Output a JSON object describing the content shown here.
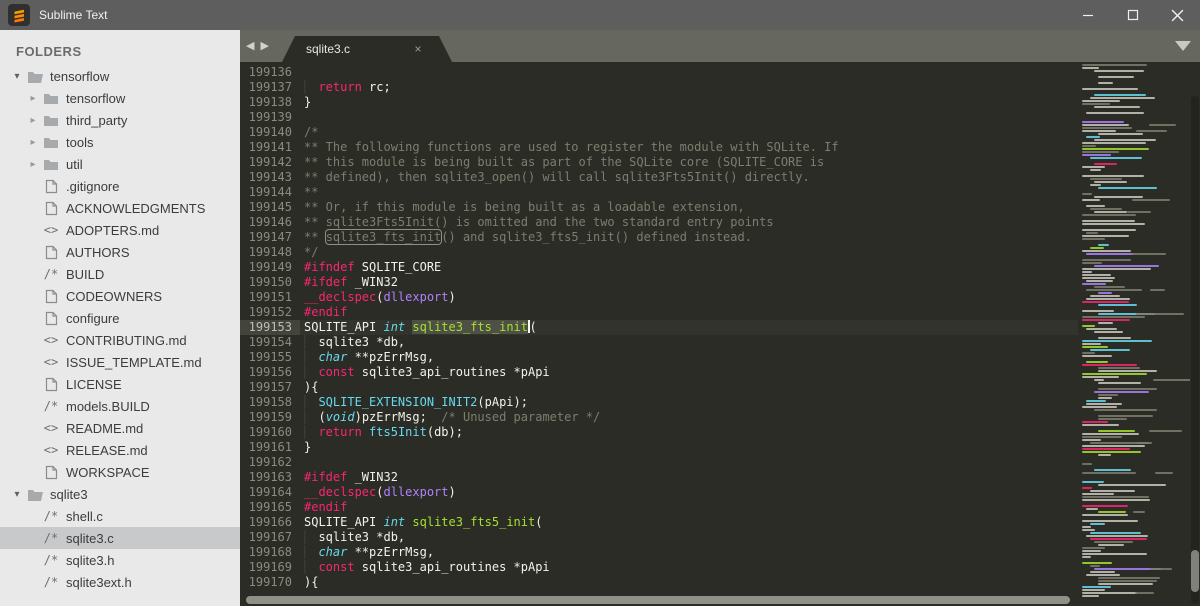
{
  "window": {
    "title": "Sublime Text",
    "controls": {
      "minimize": "minimize",
      "maximize": "maximize",
      "close": "close"
    }
  },
  "sidebar": {
    "header": "FOLDERS",
    "items": [
      {
        "label": "tensorflow",
        "icon": "folder-open",
        "depth": 0,
        "expanded": true,
        "selected": false
      },
      {
        "label": "tensorflow",
        "icon": "folder",
        "depth": 1,
        "expanded": false,
        "selected": false
      },
      {
        "label": "third_party",
        "icon": "folder",
        "depth": 1,
        "expanded": false,
        "selected": false
      },
      {
        "label": "tools",
        "icon": "folder",
        "depth": 1,
        "expanded": false,
        "selected": false
      },
      {
        "label": "util",
        "icon": "folder",
        "depth": 1,
        "expanded": false,
        "selected": false
      },
      {
        "label": ".gitignore",
        "icon": "file",
        "depth": 1,
        "selected": false
      },
      {
        "label": "ACKNOWLEDGMENTS",
        "icon": "file",
        "depth": 1,
        "selected": false
      },
      {
        "label": "ADOPTERS.md",
        "icon": "markdown",
        "depth": 1,
        "selected": false
      },
      {
        "label": "AUTHORS",
        "icon": "file",
        "depth": 1,
        "selected": false
      },
      {
        "label": "BUILD",
        "icon": "source",
        "depth": 1,
        "selected": false
      },
      {
        "label": "CODEOWNERS",
        "icon": "file",
        "depth": 1,
        "selected": false
      },
      {
        "label": "configure",
        "icon": "file",
        "depth": 1,
        "selected": false
      },
      {
        "label": "CONTRIBUTING.md",
        "icon": "markdown",
        "depth": 1,
        "selected": false
      },
      {
        "label": "ISSUE_TEMPLATE.md",
        "icon": "markdown",
        "depth": 1,
        "selected": false
      },
      {
        "label": "LICENSE",
        "icon": "file",
        "depth": 1,
        "selected": false
      },
      {
        "label": "models.BUILD",
        "icon": "source",
        "depth": 1,
        "selected": false
      },
      {
        "label": "README.md",
        "icon": "markdown",
        "depth": 1,
        "selected": false
      },
      {
        "label": "RELEASE.md",
        "icon": "markdown",
        "depth": 1,
        "selected": false
      },
      {
        "label": "WORKSPACE",
        "icon": "file",
        "depth": 1,
        "selected": false
      },
      {
        "label": "sqlite3",
        "icon": "folder-open",
        "depth": 0,
        "expanded": true,
        "selected": false
      },
      {
        "label": "shell.c",
        "icon": "source",
        "depth": 1,
        "selected": false
      },
      {
        "label": "sqlite3.c",
        "icon": "source",
        "depth": 1,
        "selected": true
      },
      {
        "label": "sqlite3.h",
        "icon": "source",
        "depth": 1,
        "selected": false
      },
      {
        "label": "sqlite3ext.h",
        "icon": "source",
        "depth": 1,
        "selected": false
      }
    ]
  },
  "tabs": {
    "active_label": "sqlite3.c",
    "close_glyph": "×"
  },
  "editor": {
    "current_line": "199153",
    "lines": [
      {
        "num": "199136",
        "tokens": []
      },
      {
        "num": "199137",
        "tokens": [
          [
            "ind",
            "  "
          ],
          [
            "kw",
            "return"
          ],
          [
            "pl",
            " rc;"
          ]
        ]
      },
      {
        "num": "199138",
        "tokens": [
          [
            "pl",
            "}"
          ]
        ]
      },
      {
        "num": "199139",
        "tokens": []
      },
      {
        "num": "199140",
        "tokens": [
          [
            "cm",
            "/*"
          ]
        ]
      },
      {
        "num": "199141",
        "tokens": [
          [
            "cm",
            "** The following functions are used to register the module with SQLite. If"
          ]
        ]
      },
      {
        "num": "199142",
        "tokens": [
          [
            "cm",
            "** this module is being built as part of the SQLite core (SQLITE_CORE is"
          ]
        ]
      },
      {
        "num": "199143",
        "tokens": [
          [
            "cm",
            "** defined), then sqlite3_open() will call sqlite3Fts5Init() directly."
          ]
        ]
      },
      {
        "num": "199144",
        "tokens": [
          [
            "cm",
            "**"
          ]
        ]
      },
      {
        "num": "199145",
        "tokens": [
          [
            "cm",
            "** Or, if this module is being built as a loadable extension,"
          ]
        ]
      },
      {
        "num": "199146",
        "tokens": [
          [
            "cm",
            "** sqlite3Fts5Init() is omitted and the two standard entry points"
          ]
        ]
      },
      {
        "num": "199147",
        "tokens": [
          [
            "cm",
            "** "
          ],
          [
            "cmbox",
            "sqlite3_fts_init"
          ],
          [
            "cm",
            "() and sqlite3_fts5_init() defined instead."
          ]
        ]
      },
      {
        "num": "199148",
        "tokens": [
          [
            "cm",
            "*/"
          ]
        ]
      },
      {
        "num": "199149",
        "tokens": [
          [
            "kw",
            "#ifndef"
          ],
          [
            "pl",
            " SQLITE_CORE"
          ]
        ]
      },
      {
        "num": "199150",
        "tokens": [
          [
            "kw",
            "#ifdef"
          ],
          [
            "pl",
            " _WIN32"
          ]
        ]
      },
      {
        "num": "199151",
        "tokens": [
          [
            "kw",
            "__declspec"
          ],
          [
            "pl",
            "("
          ],
          [
            "pu",
            "dllexport"
          ],
          [
            "pl",
            ")"
          ]
        ]
      },
      {
        "num": "199152",
        "tokens": [
          [
            "kw",
            "#endif"
          ]
        ]
      },
      {
        "num": "199153",
        "tokens": [
          [
            "pl",
            "SQLITE_API "
          ],
          [
            "ty",
            "int"
          ],
          [
            "pl",
            " "
          ],
          [
            "sel",
            "sqlite3_fts_init"
          ],
          [
            "cur",
            ""
          ],
          [
            "pl",
            "("
          ]
        ]
      },
      {
        "num": "199154",
        "tokens": [
          [
            "ind",
            "  "
          ],
          [
            "pl",
            "sqlite3 *db,"
          ]
        ]
      },
      {
        "num": "199155",
        "tokens": [
          [
            "ind",
            "  "
          ],
          [
            "ty",
            "char"
          ],
          [
            "pl",
            " **pzErrMsg,"
          ]
        ]
      },
      {
        "num": "199156",
        "tokens": [
          [
            "ind",
            "  "
          ],
          [
            "kw",
            "const"
          ],
          [
            "pl",
            " sqlite3_api_routines *pApi"
          ]
        ]
      },
      {
        "num": "199157",
        "tokens": [
          [
            "pl",
            "){"
          ]
        ]
      },
      {
        "num": "199158",
        "tokens": [
          [
            "ind",
            "  "
          ],
          [
            "fc",
            "SQLITE_EXTENSION_INIT2"
          ],
          [
            "pl",
            "(pApi);"
          ]
        ]
      },
      {
        "num": "199159",
        "tokens": [
          [
            "ind",
            "  "
          ],
          [
            "pl",
            "("
          ],
          [
            "ty",
            "void"
          ],
          [
            "pl",
            ")pzErrMsg;  "
          ],
          [
            "cm",
            "/* Unused parameter */"
          ]
        ]
      },
      {
        "num": "199160",
        "tokens": [
          [
            "ind",
            "  "
          ],
          [
            "kw",
            "return"
          ],
          [
            "pl",
            " "
          ],
          [
            "fc",
            "fts5Init"
          ],
          [
            "pl",
            "(db);"
          ]
        ]
      },
      {
        "num": "199161",
        "tokens": [
          [
            "pl",
            "}"
          ]
        ]
      },
      {
        "num": "199162",
        "tokens": []
      },
      {
        "num": "199163",
        "tokens": [
          [
            "kw",
            "#ifdef"
          ],
          [
            "pl",
            " _WIN32"
          ]
        ]
      },
      {
        "num": "199164",
        "tokens": [
          [
            "kw",
            "__declspec"
          ],
          [
            "pl",
            "("
          ],
          [
            "pu",
            "dllexport"
          ],
          [
            "pl",
            ")"
          ]
        ]
      },
      {
        "num": "199165",
        "tokens": [
          [
            "kw",
            "#endif"
          ]
        ]
      },
      {
        "num": "199166",
        "tokens": [
          [
            "pl",
            "SQLITE_API "
          ],
          [
            "ty",
            "int"
          ],
          [
            "pl",
            " "
          ],
          [
            "fn",
            "sqlite3_fts5_init"
          ],
          [
            "pl",
            "("
          ]
        ]
      },
      {
        "num": "199167",
        "tokens": [
          [
            "ind",
            "  "
          ],
          [
            "pl",
            "sqlite3 *db,"
          ]
        ]
      },
      {
        "num": "199168",
        "tokens": [
          [
            "ind",
            "  "
          ],
          [
            "ty",
            "char"
          ],
          [
            "pl",
            " **pzErrMsg,"
          ]
        ]
      },
      {
        "num": "199169",
        "tokens": [
          [
            "ind",
            "  "
          ],
          [
            "kw",
            "const"
          ],
          [
            "pl",
            " sqlite3_api_routines *pApi"
          ]
        ]
      },
      {
        "num": "199170",
        "tokens": [
          [
            "pl",
            "){"
          ]
        ]
      }
    ]
  },
  "colors": {
    "titlebar_bg": "#5e5e5e",
    "sidebar_bg": "#e9e9e9",
    "sidebar_selected_bg": "#c7c9cb",
    "tabbar_bg": "#66685f",
    "editor_bg": "#2b2c25",
    "keyword": "#f92672",
    "type": "#66d9ef",
    "function": "#a6e22e",
    "constant": "#ae81ff",
    "comment": "#7c7e6f",
    "plain": "#f2f2ea",
    "logo_orange": "#ff9a00"
  }
}
